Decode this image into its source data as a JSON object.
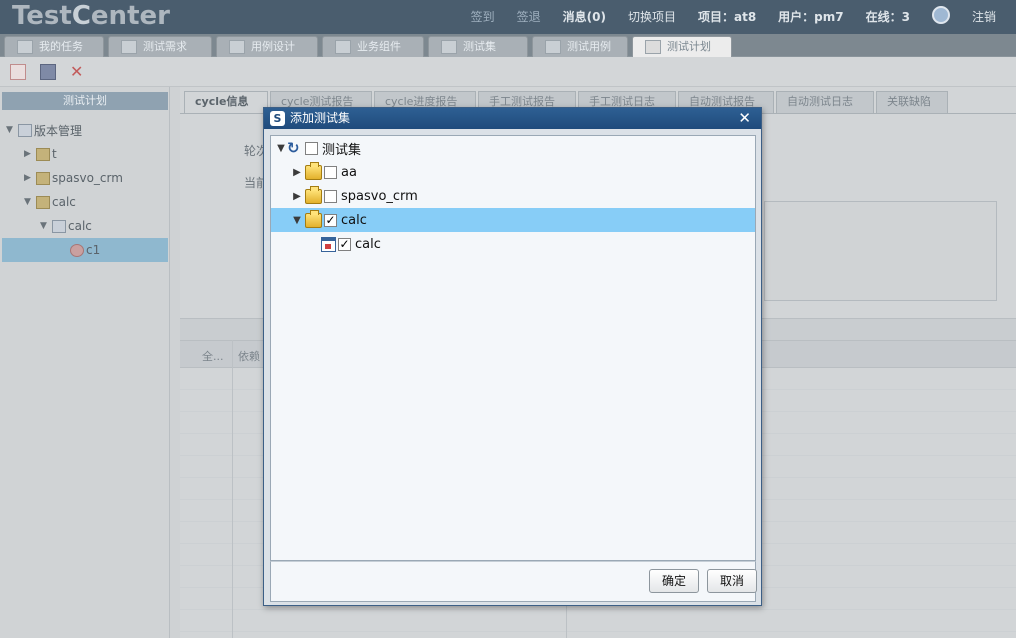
{
  "header": {
    "logo_prefix": "Test",
    "logo_c": "C",
    "logo_suffix": "enter",
    "links": {
      "sign_in": "签到",
      "sign_out": "签退",
      "messages": "消息(0)",
      "switch_project": "切换项目",
      "project": "项目：at8",
      "user": "用户：pm7",
      "online": "在线：3",
      "logout": "注销"
    }
  },
  "tabs": [
    {
      "label": "我的任务"
    },
    {
      "label": "测试需求"
    },
    {
      "label": "用例设计"
    },
    {
      "label": "业务组件"
    },
    {
      "label": "测试集"
    },
    {
      "label": "测试用例"
    },
    {
      "label": "测试计划"
    }
  ],
  "left_panel": {
    "title": "测试计划",
    "tree": {
      "root": "版本管理",
      "items": [
        "t",
        "spasvo_crm",
        "calc"
      ],
      "child": "calc",
      "leaf": "c1"
    }
  },
  "content_tabs": [
    {
      "label": "cycle信息"
    },
    {
      "label": "cycle测试报告"
    },
    {
      "label": "cycle进度报告"
    },
    {
      "label": "手工测试报告"
    },
    {
      "label": "手工测试日志"
    },
    {
      "label": "自动测试报告"
    },
    {
      "label": "自动测试日志"
    },
    {
      "label": "关联缺陷"
    }
  ],
  "form": {
    "label1": "轮次",
    "label2": "当前"
  },
  "grid": {
    "col_all": "全...",
    "col_dep": "依赖"
  },
  "modal": {
    "title": "添加测试集",
    "tree": {
      "root": {
        "label": "测试集",
        "checked": false
      },
      "items": [
        {
          "label": "aa",
          "checked": false
        },
        {
          "label": "spasvo_crm",
          "checked": false
        },
        {
          "label": "calc",
          "checked": true
        }
      ],
      "child": {
        "label": "calc",
        "checked": true
      }
    },
    "ok_label": "确定",
    "cancel_label": "取消"
  },
  "colors": {
    "modal_title_bg": "#1f4b7c",
    "selected_row": "#87cdf7"
  }
}
